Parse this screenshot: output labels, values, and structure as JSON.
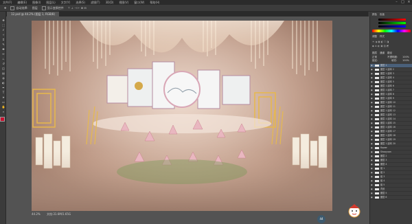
{
  "menu": [
    "文件(F)",
    "编辑(E)",
    "图像(I)",
    "图层(L)",
    "文字(Y)",
    "选择(S)",
    "滤镜(T)",
    "3D(D)",
    "视图(V)",
    "窗口(W)",
    "帮助(H)"
  ],
  "options": {
    "auto_select": "自动选择:",
    "layer_select": "图层",
    "transform": "显示变换控件"
  },
  "document_tab": "12.psd @ 44.2% (图层 1, RGB/8)",
  "zoom": "44.2%",
  "zoom_badge": "44",
  "status_doc": "文档:31.6M/1.65G",
  "panel": {
    "color_tabs": [
      "颜色",
      "色板"
    ],
    "adj_tabs": [
      "调整",
      "样式"
    ],
    "layer_tabs": [
      "图层",
      "通道",
      "路径"
    ],
    "blend_mode": "正常",
    "opacity_label": "不透明度:",
    "opacity": "100%",
    "lock_label": "锁定:",
    "fill_label": "填充:",
    "fill": "100%"
  },
  "layers": [
    {
      "name": "图层 1"
    },
    {
      "name": "图层 1 副本 2"
    },
    {
      "name": "图层 1 副本 3"
    },
    {
      "name": "图层 1 副本 4"
    },
    {
      "name": "图层 1 副本 5"
    },
    {
      "name": "图层 1 副本 6"
    },
    {
      "name": "图层 1 副本 7"
    },
    {
      "name": "图层 1 副本 8"
    },
    {
      "name": "图层 1 副本 9"
    },
    {
      "name": "图层 1 副本 10"
    },
    {
      "name": "图层 1 副本 11"
    },
    {
      "name": "图层 1 副本 12"
    },
    {
      "name": "图层 1 副本 13"
    },
    {
      "name": "图层 1 副本 14"
    },
    {
      "name": "图层 1 副本 15"
    },
    {
      "name": "图层 1 副本 16"
    },
    {
      "name": "图层 1 副本 17"
    },
    {
      "name": "图层 1 副本 18"
    },
    {
      "name": "图层 1 副本 19"
    },
    {
      "name": "图层 1 副本 20"
    },
    {
      "name": "flower"
    },
    {
      "name": "Shaoyuan"
    },
    {
      "name": "图层 2"
    },
    {
      "name": "图层 3"
    },
    {
      "name": "图层 4"
    },
    {
      "name": "组 1"
    },
    {
      "name": "组 2"
    },
    {
      "name": "组 3"
    },
    {
      "name": "组 4"
    },
    {
      "name": "组 5"
    },
    {
      "name": "背景"
    },
    {
      "name": "图层 5"
    },
    {
      "name": "图层 6"
    }
  ],
  "colors": {
    "accent": "#c8102e",
    "foreground": "#c8102e",
    "background": "#ffffff"
  }
}
